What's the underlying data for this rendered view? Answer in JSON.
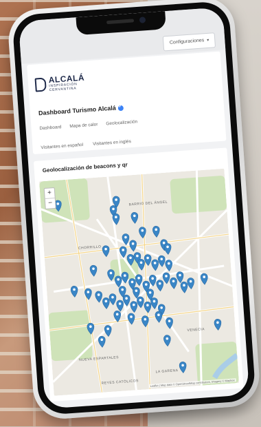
{
  "app": {
    "config_button": "Configuraciones",
    "logo_title": "ALCALÁ",
    "logo_sub_1": "INSPIRACIÓN",
    "logo_sub_2": "CERVANTINA",
    "dashboard_title": "Dashboard Turismo Alcalá"
  },
  "tabs": [
    {
      "label": "Dashboard"
    },
    {
      "label": "Mapa de calor"
    },
    {
      "label": "Geolocalización"
    }
  ],
  "subtabs": [
    {
      "label": "Visitantes en español"
    },
    {
      "label": "Visitantes en inglés"
    }
  ],
  "map": {
    "title": "Geolocalización de beacons y qr",
    "zoom_in": "+",
    "zoom_out": "−",
    "attribution": "Leaflet | Map data © OpenStreetMap contributors, Imagery © Mapbox",
    "labels": [
      {
        "text": "BARRIO DEL ÁNGEL"
      },
      {
        "text": "CHORRILLO"
      },
      {
        "text": "VENECIA"
      },
      {
        "text": "NUEVA ESPARTALES"
      },
      {
        "text": "REYES CATÓLICOS"
      },
      {
        "text": "LA GARENA"
      }
    ],
    "marker_color": "#3a86c6",
    "park_color": "#cfe3b9",
    "road_color": "#ffffff"
  }
}
